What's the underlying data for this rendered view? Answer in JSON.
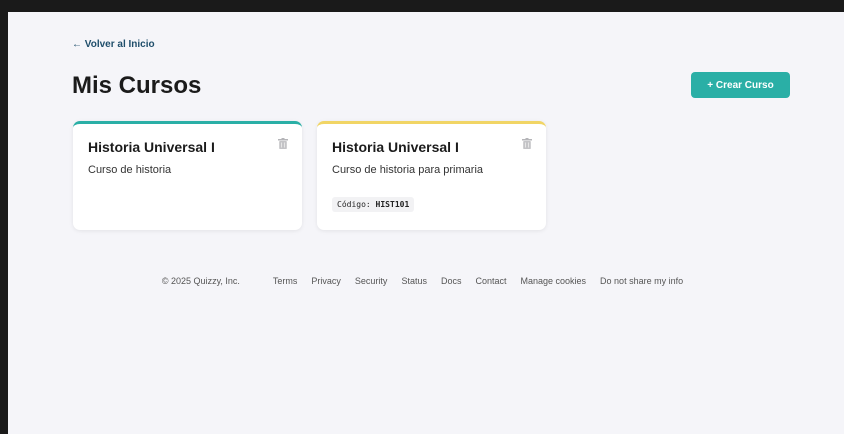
{
  "nav": {
    "back_label": "← Volver al Inicio"
  },
  "header": {
    "title": "Mis Cursos",
    "create_label": "+ Crear Curso"
  },
  "courses": [
    {
      "title": "Historia Universal I",
      "description": "Curso de historia",
      "accent": "#2aafa6"
    },
    {
      "title": "Historia Universal I",
      "description": "Curso de historia para primaria",
      "code_label": "Código:",
      "code_value": "HIST101",
      "accent": "#f1d565"
    }
  ],
  "footer": {
    "copyright": "© 2025 Quizzy, Inc.",
    "links": [
      "Terms",
      "Privacy",
      "Security",
      "Status",
      "Docs",
      "Contact",
      "Manage cookies",
      "Do not share my info"
    ]
  },
  "colors": {
    "primary": "#2aafa6",
    "background": "#f5f5f9",
    "link": "#1f4e6b"
  }
}
